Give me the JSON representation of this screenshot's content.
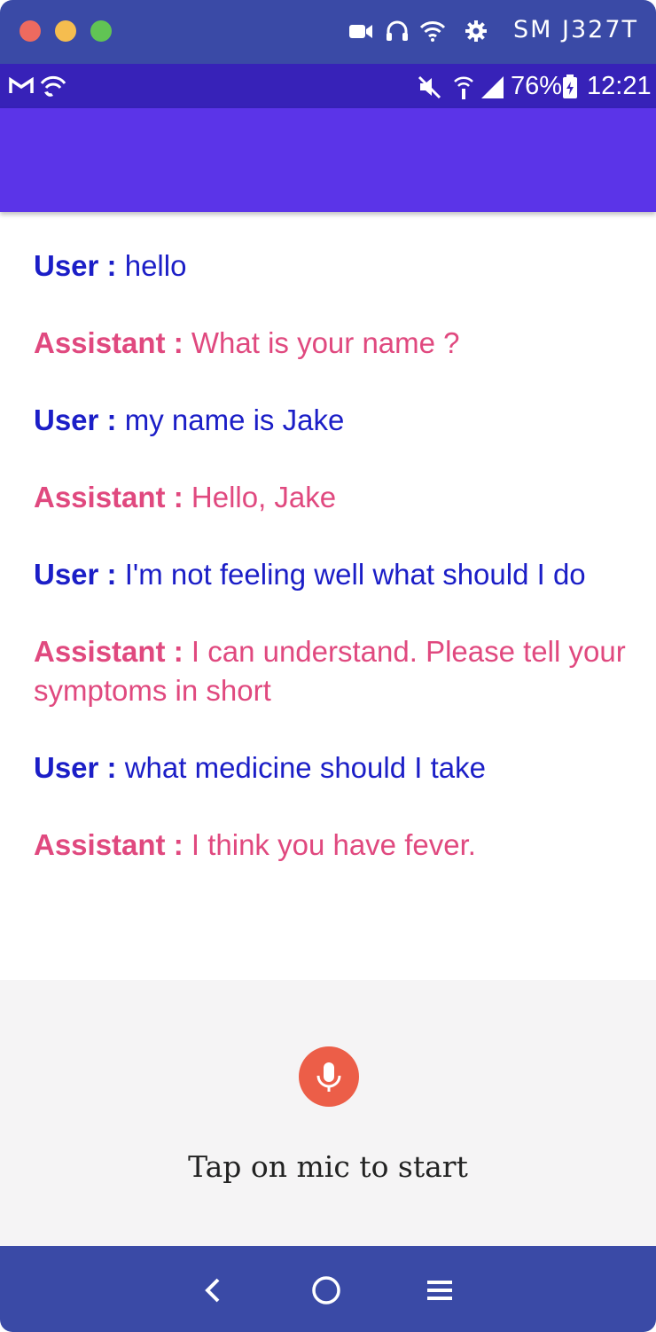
{
  "window": {
    "device_name": "SM J327T",
    "icons": [
      "video-camera-icon",
      "headphones-icon",
      "wifi-icon",
      "gear-icon"
    ]
  },
  "status_bar": {
    "left_icons": [
      "gmail-icon",
      "wifi-calling-icon"
    ],
    "right_icons": [
      "mute-icon",
      "hotspot-icon",
      "signal-icon",
      "battery-icon"
    ],
    "battery": "76%",
    "time": "12:21"
  },
  "chat": {
    "messages": [
      {
        "role": "User",
        "sep": " : ",
        "text": "hello"
      },
      {
        "role": "Assistant",
        "sep": " : ",
        "text": "What is your name ?"
      },
      {
        "role": "User",
        "sep": " : ",
        "text": "my name is Jake"
      },
      {
        "role": "Assistant",
        "sep": " : ",
        "text": "Hello, Jake"
      },
      {
        "role": "User",
        "sep": " : ",
        "text": "I'm not feeling well what should I do"
      },
      {
        "role": "Assistant",
        "sep": " : ",
        "text": "I can understand. Please tell your symptoms in short"
      },
      {
        "role": "User",
        "sep": " : ",
        "text": "what medicine should I take"
      },
      {
        "role": "Assistant",
        "sep": " : ",
        "text": "I think you have fever."
      }
    ]
  },
  "voice": {
    "mic_icon": "microphone-icon",
    "hint": "Tap on mic to start"
  },
  "nav": {
    "buttons": [
      "back-icon",
      "home-icon",
      "menu-icon"
    ]
  },
  "colors": {
    "user_text": "#1b1ec7",
    "assistant_text": "#e0497f",
    "app_bar": "#5b34e8",
    "status_bar": "#3722b8",
    "mic": "#ec5e48"
  }
}
